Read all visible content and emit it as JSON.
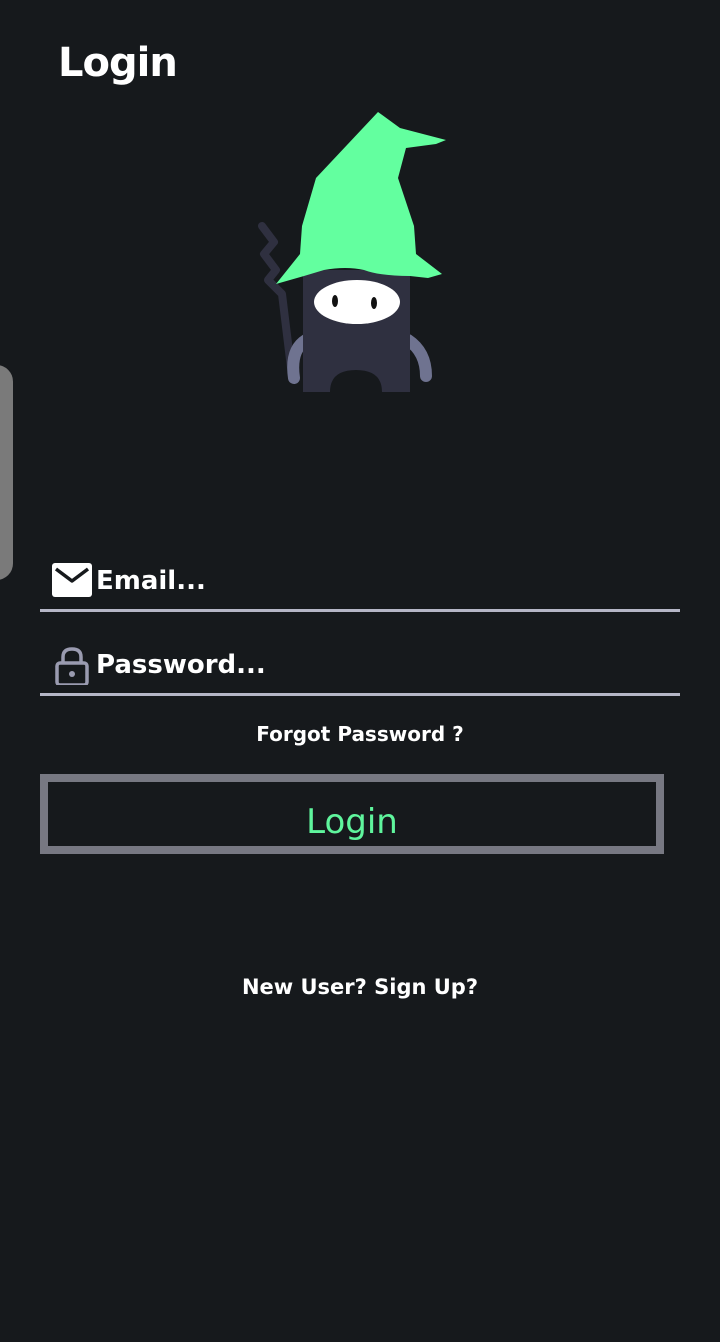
{
  "header": {
    "title": "Login"
  },
  "illustration": {
    "name": "wizard-mascot",
    "hat_color": "#63ff9f",
    "body_color": "#2f3040"
  },
  "form": {
    "email": {
      "icon": "mail-icon",
      "placeholder": "Email...",
      "value": ""
    },
    "password": {
      "icon": "lock-icon",
      "placeholder": "Password...",
      "value": ""
    },
    "forgot_password_label": "Forgot Password ?",
    "login_button_label": "Login"
  },
  "footer": {
    "signup_label": "New User? Sign Up?"
  },
  "colors": {
    "background": "#16191c",
    "accent": "#5ff59d",
    "button_border": "#777882",
    "field_underline": "#b5b6c6"
  }
}
